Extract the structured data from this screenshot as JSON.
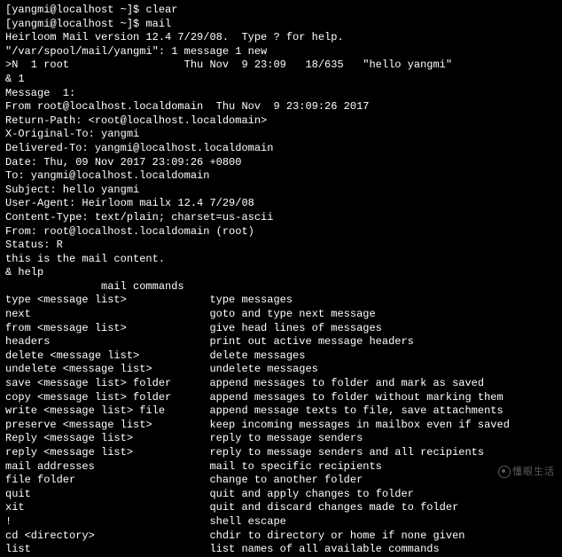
{
  "prompt1": "[yangmi@localhost ~]$ ",
  "cmd1": "clear",
  "prompt2": "[yangmi@localhost ~]$ ",
  "cmd2": "mail",
  "banner": "Heirloom Mail version 12.4 7/29/08.  Type ? for help.",
  "spool": "\"/var/spool/mail/yangmi\": 1 message 1 new",
  "list1": ">N  1 root                  Thu Nov  9 23:09   18/635   \"hello yangmi\"",
  "amp1": "& 1",
  "msg_hdr": "Message  1:",
  "from_line": "From root@localhost.localdomain  Thu Nov  9 23:09:26 2017",
  "return_path": "Return-Path: <root@localhost.localdomain>",
  "x_orig": "X-Original-To: yangmi",
  "delivered": "Delivered-To: yangmi@localhost.localdomain",
  "date_line": "Date: Thu, 09 Nov 2017 23:09:26 +0800",
  "to_line": "To: yangmi@localhost.localdomain",
  "subject": "Subject: hello yangmi",
  "ua": "User-Agent: Heirloom mailx 12.4 7/29/08",
  "ctype": "Content-Type: text/plain; charset=us-ascii",
  "from2": "From: root@localhost.localdomain (root)",
  "status": "Status: R",
  "blank": "",
  "body": "this is the mail content.",
  "amp_help": "& help",
  "help_title": "               mail commands",
  "help": [
    "type <message list>             type messages",
    "next                            goto and type next message",
    "from <message list>             give head lines of messages",
    "headers                         print out active message headers",
    "delete <message list>           delete messages",
    "undelete <message list>         undelete messages",
    "save <message list> folder      append messages to folder and mark as saved",
    "copy <message list> folder      append messages to folder without marking them",
    "write <message list> file       append message texts to file, save attachments",
    "preserve <message list>         keep incoming messages in mailbox even if saved",
    "Reply <message list>            reply to message senders",
    "reply <message list>            reply to message senders and all recipients",
    "mail addresses                  mail to specific recipients",
    "file folder                     change to another folder",
    "quit                            quit and apply changes to folder",
    "xit                             quit and discard changes made to folder",
    "!                               shell escape",
    "cd <directory>                  chdir to directory or home if none given",
    "list                            list names of all available commands"
  ],
  "watermark": "懂眼生活"
}
